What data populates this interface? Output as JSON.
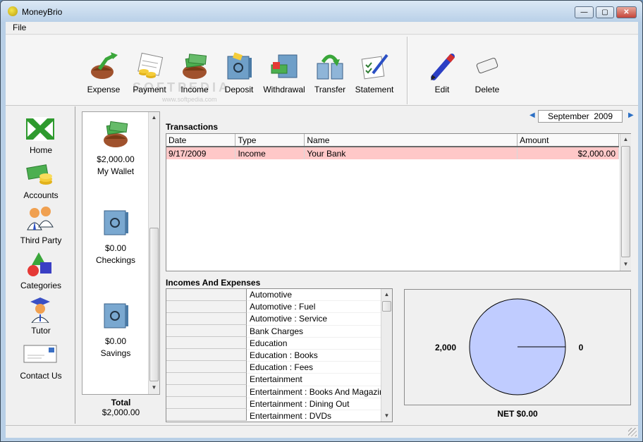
{
  "window": {
    "title": "MoneyBrio",
    "minimize": "—",
    "maximize": "▢",
    "close": "✕"
  },
  "menu": {
    "file": "File"
  },
  "toolbar": {
    "watermark": "SOFTPEDIA",
    "watermark_sub": "www.softpedia.com",
    "buttons": [
      {
        "label": "Expense",
        "icon": "expense-icon"
      },
      {
        "label": "Payment",
        "icon": "payment-icon"
      },
      {
        "label": "Income",
        "icon": "income-icon"
      },
      {
        "label": "Deposit",
        "icon": "deposit-icon"
      },
      {
        "label": "Withdrawal",
        "icon": "withdrawal-icon"
      },
      {
        "label": "Transfer",
        "icon": "transfer-icon"
      },
      {
        "label": "Statement",
        "icon": "statement-icon"
      },
      {
        "label": "Edit",
        "icon": "pen-icon"
      },
      {
        "label": "Delete",
        "icon": "eraser-icon"
      }
    ]
  },
  "nav": [
    {
      "label": "Home",
      "icon": "home-arrows-icon"
    },
    {
      "label": "Accounts",
      "icon": "money-icon"
    },
    {
      "label": "Third Party",
      "icon": "people-icon"
    },
    {
      "label": "Categories",
      "icon": "shapes-icon"
    },
    {
      "label": "Tutor",
      "icon": "tutor-icon"
    },
    {
      "label": "Contact Us",
      "icon": "envelope-icon"
    }
  ],
  "accounts": [
    {
      "amount": "$2,000.00",
      "name": "My Wallet",
      "icon": "wallet-icon"
    },
    {
      "amount": "$0.00",
      "name": "Checkings",
      "icon": "safe-icon"
    },
    {
      "amount": "$0.00",
      "name": "Savings",
      "icon": "safe-icon"
    }
  ],
  "total": {
    "label": "Total",
    "value": "$2,000.00"
  },
  "period": {
    "month": "September",
    "year": "2009"
  },
  "transactions": {
    "title": "Transactions",
    "columns": [
      "Date",
      "Type",
      "Name",
      "Amount"
    ],
    "rows": [
      {
        "date": "9/17/2009",
        "type": "Income",
        "name": "Your Bank",
        "amount": "$2,000.00"
      }
    ]
  },
  "incomes_expenses": {
    "title": "Incomes And Expenses",
    "categories": [
      "Automotive",
      "Automotive : Fuel",
      "Automotive : Service",
      "Bank Charges",
      "Education",
      "Education : Books",
      "Education : Fees",
      "Entertainment",
      "Entertainment : Books And Magazines",
      "Entertainment : Dining Out",
      "Entertainment : DVDs"
    ]
  },
  "chart_data": {
    "type": "pie",
    "title": "",
    "slices": [
      {
        "label": "2,000",
        "value": 2000
      },
      {
        "label": "0",
        "value": 0
      }
    ],
    "color": "#c0ccff",
    "net_label": "NET $0.00"
  }
}
